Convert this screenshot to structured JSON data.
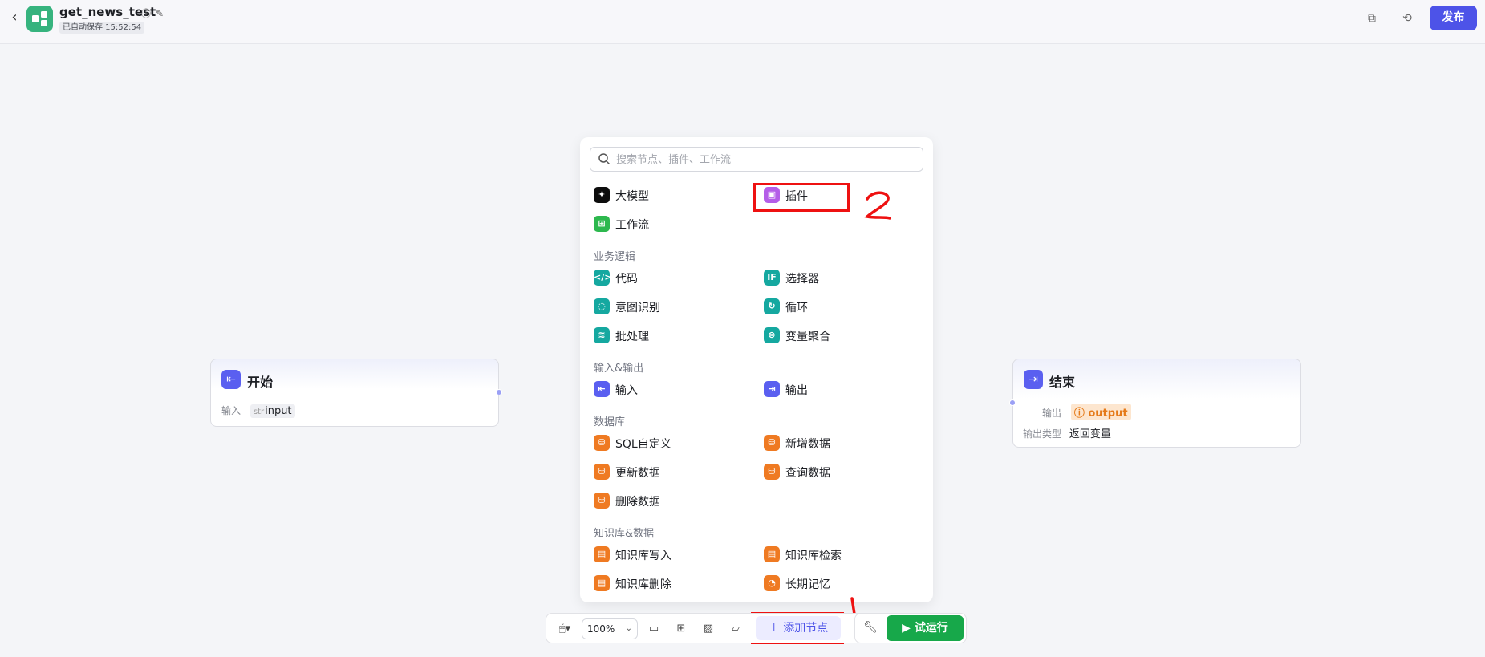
{
  "header": {
    "back_icon": "chevron-left-icon",
    "app_title": "get_news_test",
    "autosave": "已自动保存 15:52:54",
    "publish_label": "发布"
  },
  "nodes": {
    "start": {
      "title": "开始",
      "row_label": "输入",
      "type": "str",
      "var": "input"
    },
    "end": {
      "title": "结束",
      "row1_label": "输出",
      "var": "output",
      "row2_label": "输出类型",
      "row2_value": "返回变量"
    }
  },
  "popup": {
    "search_placeholder": "搜索节点、插件、工作流",
    "top_items": [
      {
        "label": "大模型",
        "icon": "llm-icon",
        "color": "#0d0d0d"
      },
      {
        "label": "插件",
        "icon": "plugin-icon",
        "color": "#b45ee8"
      },
      {
        "label": "工作流",
        "icon": "workflow-icon",
        "color": "#2db84e"
      }
    ],
    "sections": [
      {
        "title": "业务逻辑",
        "items": [
          "代码",
          "选择器",
          "意图识别",
          "循环",
          "批处理",
          "变量聚合"
        ]
      },
      {
        "title": "输入&输出",
        "items": [
          "输入",
          "输出"
        ]
      },
      {
        "title": "数据库",
        "items": [
          "SQL自定义",
          "新增数据",
          "更新数据",
          "查询数据",
          "删除数据"
        ]
      },
      {
        "title": "知识库&数据",
        "items": [
          "知识库写入",
          "知识库检索",
          "知识库删除",
          "长期记忆"
        ]
      }
    ]
  },
  "toolbar": {
    "zoom": "100%",
    "add_node_label": "添加节点",
    "run_label": "试运行"
  },
  "annotations": {
    "mark_1": "1",
    "mark_2": "2",
    "color": "#ee1111"
  }
}
